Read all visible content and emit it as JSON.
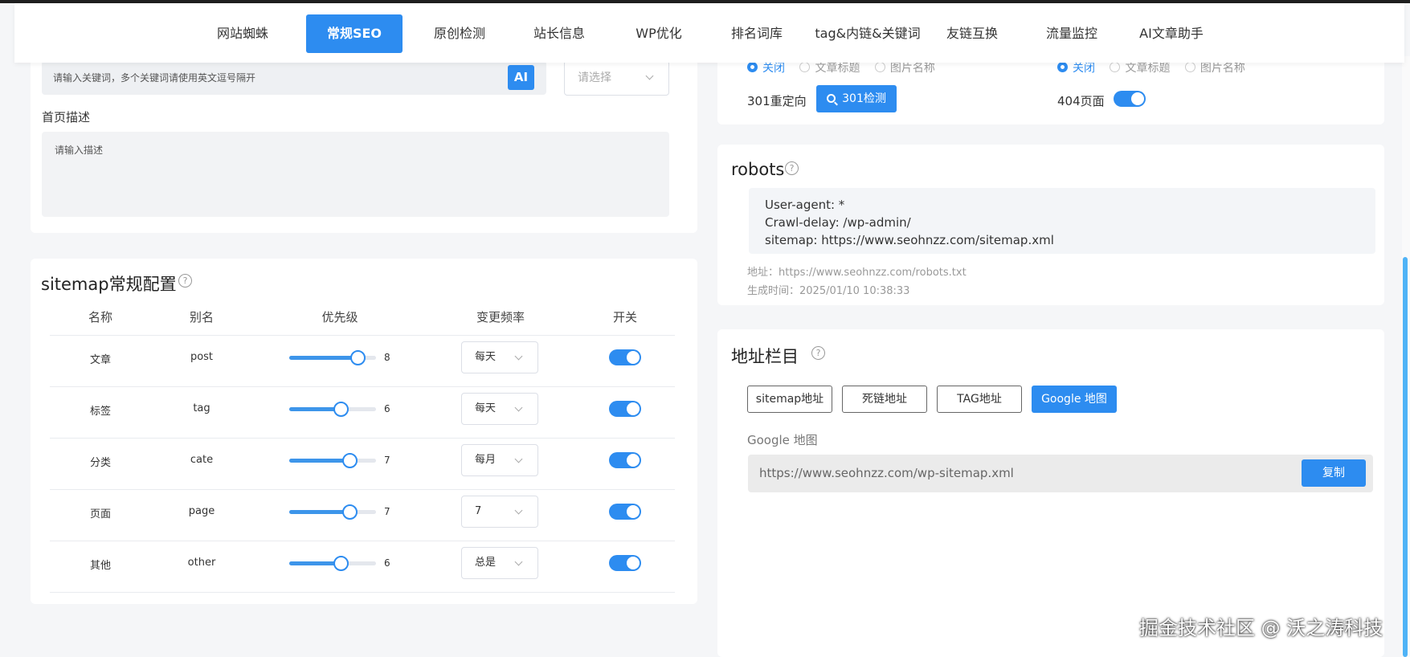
{
  "nav": {
    "items": [
      {
        "label": "网站蜘蛛"
      },
      {
        "label": "常规SEO"
      },
      {
        "label": "原创检测"
      },
      {
        "label": "站长信息"
      },
      {
        "label": "WP优化"
      },
      {
        "label": "排名词库"
      },
      {
        "label": "tag&内链&关键词"
      },
      {
        "label": "友链互换"
      },
      {
        "label": "流量监控"
      },
      {
        "label": "AI文章助手"
      }
    ],
    "active_index": 1
  },
  "keywords": {
    "placeholder": "请输入关键词，多个关键词请使用英文逗号隔开",
    "ai_label": "AI",
    "select_placeholder": "请选择"
  },
  "home_desc": {
    "label": "首页描述",
    "placeholder": "请输入描述"
  },
  "sitemap": {
    "title": "sitemap常规配置",
    "headers": [
      "名称",
      "别名",
      "优先级",
      "变更频率",
      "开关"
    ],
    "rows": [
      {
        "name": "文章",
        "alias": "post",
        "priority": 8,
        "priority_text": "8",
        "freq": "每天",
        "enabled": true
      },
      {
        "name": "标签",
        "alias": "tag",
        "priority": 6,
        "priority_text": "6",
        "freq": "每天",
        "enabled": true
      },
      {
        "name": "分类",
        "alias": "cate",
        "priority": 7,
        "priority_text": "7",
        "freq": "每月",
        "enabled": true
      },
      {
        "name": "页面",
        "alias": "page",
        "priority": 7,
        "priority_text": "7",
        "freq": "7",
        "enabled": true
      },
      {
        "name": "其他",
        "alias": "other",
        "priority": 6,
        "priority_text": "6",
        "freq": "总是",
        "enabled": true
      }
    ],
    "priority_max": 10
  },
  "right_top": {
    "radio_group_1": [
      "关闭",
      "文章标题",
      "图片名称"
    ],
    "radio_group_2": [
      "关闭",
      "文章标题",
      "图片名称"
    ],
    "redirect_label": "301重定向",
    "check_button": "301检测",
    "page404_label": "404页面"
  },
  "robots": {
    "title": "robots",
    "lines": [
      "User-agent: *",
      "Crawl-delay: /wp-admin/",
      "sitemap: https://www.seohnzz.com/sitemap.xml"
    ],
    "address": "地址：https://www.seohnzz.com/robots.txt",
    "generated": "生成时间：2025/01/10 10:38:33"
  },
  "address_bar": {
    "title": "地址栏目",
    "buttons": [
      "sitemap地址",
      "死链地址",
      "TAG地址",
      "Google 地图"
    ],
    "active_index": 3,
    "current_label": "Google 地图",
    "current_url": "https://www.seohnzz.com/wp-sitemap.xml",
    "copy_label": "复制"
  },
  "watermark": "掘金技术社区 @ 沃之涛科技",
  "colors": {
    "primary": "#2d8cf0",
    "toggle_on": "#2d8cf0"
  }
}
